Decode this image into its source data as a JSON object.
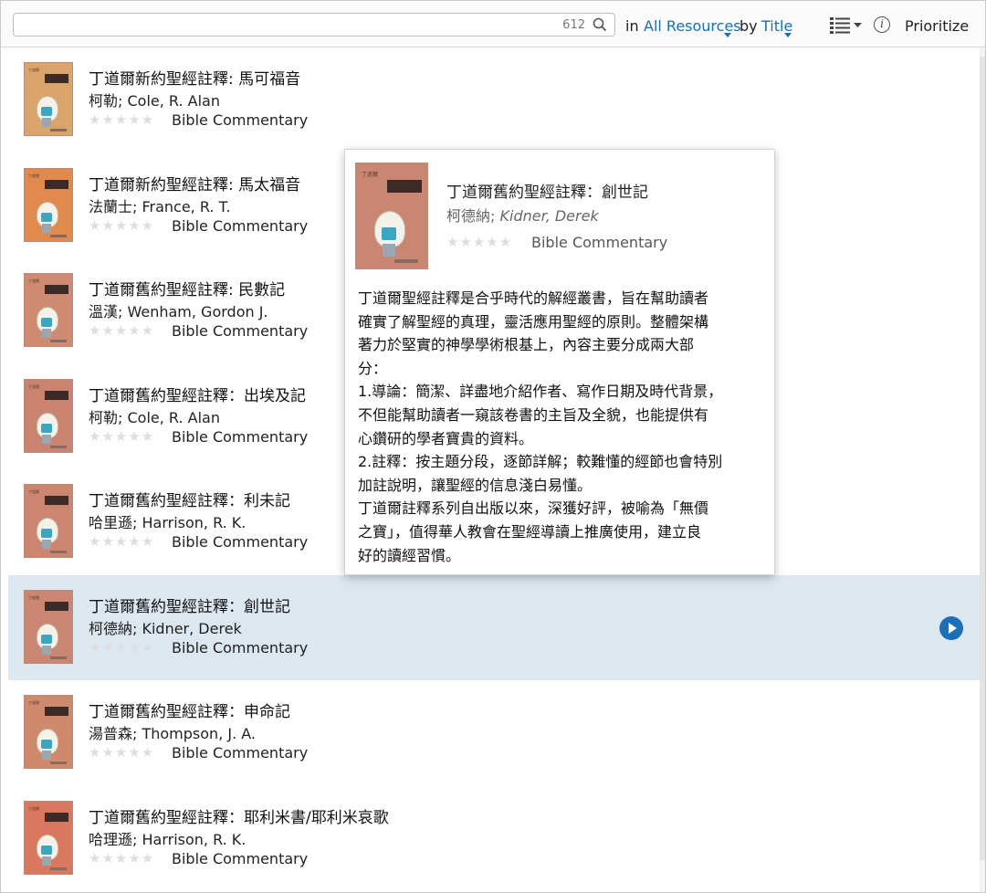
{
  "toolbar": {
    "search_value": "",
    "search_count": "612",
    "in_label": "in",
    "resource_filter": "All Resources",
    "by_label": "by",
    "sort_field": "Title",
    "prioritize_label": "Prioritize"
  },
  "results": [
    {
      "title": "丁道爾新約聖經註釋: 馬可福音",
      "author": "柯勒; Cole, R. Alan",
      "type": "Bible Commentary",
      "rating": 0,
      "cover_color": "#d9a56a"
    },
    {
      "title": "丁道爾新約聖經註釋: 馬太福音",
      "author": "法蘭士; France, R. T.",
      "type": "Bible Commentary",
      "rating": 0,
      "cover_color": "#e08a4e"
    },
    {
      "title": "丁道爾舊約聖經註釋: 民數記",
      "author": "溫漢; Wenham, Gordon J.",
      "type": "Bible Commentary",
      "rating": 0,
      "cover_color": "#cf8a72"
    },
    {
      "title": "丁道爾舊約聖經註釋：出埃及記",
      "author": "柯勒; Cole, R. Alan",
      "type": "Bible Commentary",
      "rating": 0,
      "cover_color": "#c9836e"
    },
    {
      "title": "丁道爾舊約聖經註釋：利未記",
      "author": "哈里遜; Harrison, R. K.",
      "type": "Bible Commentary",
      "rating": 0,
      "cover_color": "#cc8670"
    },
    {
      "title": "丁道爾舊約聖經註釋：創世記",
      "author": "柯德納; Kidner, Derek",
      "type": "Bible Commentary",
      "rating": 0,
      "cover_color": "#c98672",
      "selected": true
    },
    {
      "title": "丁道爾舊約聖經註釋：申命記",
      "author": "湯普森; Thompson, J. A.",
      "type": "Bible Commentary",
      "rating": 0,
      "cover_color": "#cf8a6c"
    },
    {
      "title": "丁道爾舊約聖經註釋：耶利米書/耶利米哀歌",
      "author": "哈理遜; Harrison, R. K.",
      "type": "Bible Commentary",
      "rating": 0,
      "cover_color": "#d9785e"
    }
  ],
  "popup": {
    "title": "丁道爾舊約聖經註釋：創世記",
    "author_cn": "柯德納;",
    "author_latin": "Kidner, Derek",
    "type": "Bible Commentary",
    "rating": 0,
    "description": [
      "丁道爾聖經註釋是合乎時代的解經叢書，旨在幫助讀者",
      "確實了解聖經的真理，靈活應用聖經的原則。整體架構",
      "著力於堅實的神學學術根基上，內容主要分成兩大部",
      "分：",
      "1.導論：簡潔、詳盡地介紹作者、寫作日期及時代背景，",
      "不但能幫助讀者一窺該卷書的主旨及全貌，也能提供有",
      "心鑽研的學者寶貴的資料。",
      "2.註釋：按主題分段，逐節詳解；較難懂的經節也會特別",
      "加註說明，讓聖經的信息淺白易懂。",
      "丁道爾註釋系列自出版以來，深獲好評，被喻為「無價",
      "之寶」，值得華人教會在聖經導讀上推廣使用，建立良",
      "好的讀經習慣。"
    ]
  },
  "stars_glyph": "★★★★★",
  "colors": {
    "accent": "#1a6fb5",
    "selected_row": "#dce7f0"
  }
}
